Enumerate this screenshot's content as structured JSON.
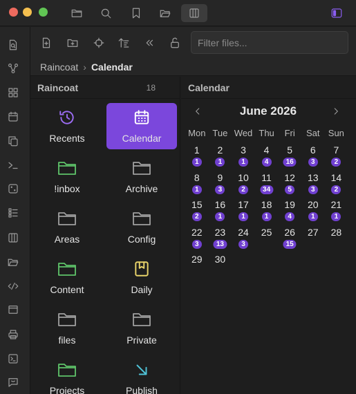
{
  "app": {
    "window_dots": [
      "#ed6a5e",
      "#f4bf4f",
      "#61c554"
    ],
    "accent": "#7b47dc",
    "titlebar_icons": [
      "folder-icon",
      "search-icon",
      "bookmark-icon",
      "folder-open-icon",
      "columns-icon"
    ],
    "sidebar_toggle_icon": "sidebar-toggle-icon"
  },
  "ribbon": {
    "icons": [
      "file-search-icon",
      "graph-icon",
      "grid-icon",
      "calendar-icon",
      "copy-icon",
      "terminal-icon",
      "dice-icon",
      "list-icon",
      "columns-icon",
      "folder-open-icon",
      "percent-code-icon",
      "window-icon",
      "print-icon",
      "terminal-box-icon",
      "chat-icon"
    ]
  },
  "toolbar": {
    "icons": [
      "new-note-icon",
      "new-folder-icon",
      "crosshair-icon",
      "sort-icon",
      "collapse-icon",
      "unlock-icon"
    ],
    "filter_placeholder": "Filter files..."
  },
  "breadcrumb": {
    "parent": "Raincoat",
    "separator": "›",
    "current": "Calendar"
  },
  "left_pane": {
    "title": "Raincoat",
    "count": "18",
    "tiles": [
      {
        "label": "Recents",
        "icon": "history-icon",
        "color": "#9b6cf2",
        "active": false
      },
      {
        "label": "Calendar",
        "icon": "calendar-icon",
        "color": "#ffffff",
        "active": true
      },
      {
        "label": "!inbox",
        "icon": "folder-icon",
        "color": "#5fc46a",
        "active": false
      },
      {
        "label": "Archive",
        "icon": "folder-icon",
        "color": "#a0a0a0",
        "active": false
      },
      {
        "label": "Areas",
        "icon": "folder-icon",
        "color": "#a0a0a0",
        "active": false
      },
      {
        "label": "Config",
        "icon": "folder-icon",
        "color": "#a0a0a0",
        "active": false
      },
      {
        "label": "Content",
        "icon": "folder-icon",
        "color": "#5fc46a",
        "active": false
      },
      {
        "label": "Daily",
        "icon": "bookmark-book-icon",
        "color": "#e8d36a",
        "active": false
      },
      {
        "label": "files",
        "icon": "folder-icon",
        "color": "#a0a0a0",
        "active": false
      },
      {
        "label": "Private",
        "icon": "folder-icon",
        "color": "#a0a0a0",
        "active": false
      },
      {
        "label": "Projects",
        "icon": "folder-icon",
        "color": "#5fc46a",
        "active": false
      },
      {
        "label": "Publish",
        "icon": "arrow-down-right-icon",
        "color": "#4fc3d8",
        "active": false
      }
    ]
  },
  "calendar": {
    "pane_title": "Calendar",
    "month_label": "June 2026",
    "weekdays": [
      "Mon",
      "Tue",
      "Wed",
      "Thu",
      "Fri",
      "Sat",
      "Sun"
    ],
    "weeks": [
      [
        {
          "d": "1",
          "n": "1"
        },
        {
          "d": "2",
          "n": "1"
        },
        {
          "d": "3",
          "n": "1"
        },
        {
          "d": "4",
          "n": "4"
        },
        {
          "d": "5",
          "n": "16"
        },
        {
          "d": "6",
          "n": "3"
        },
        {
          "d": "7",
          "n": "2"
        }
      ],
      [
        {
          "d": "8",
          "n": "1"
        },
        {
          "d": "9",
          "n": "3"
        },
        {
          "d": "10",
          "n": "2"
        },
        {
          "d": "11",
          "n": "34"
        },
        {
          "d": "12",
          "n": "5"
        },
        {
          "d": "13",
          "n": "3"
        },
        {
          "d": "14",
          "n": "2"
        }
      ],
      [
        {
          "d": "15",
          "n": "2"
        },
        {
          "d": "16",
          "n": "1"
        },
        {
          "d": "17",
          "n": "1"
        },
        {
          "d": "18",
          "n": "1"
        },
        {
          "d": "19",
          "n": "4"
        },
        {
          "d": "20",
          "n": "1"
        },
        {
          "d": "21",
          "n": "1"
        }
      ],
      [
        {
          "d": "22",
          "n": "3"
        },
        {
          "d": "23",
          "n": "13"
        },
        {
          "d": "24",
          "n": "3"
        },
        {
          "d": "25",
          "n": ""
        },
        {
          "d": "26",
          "n": "15"
        },
        {
          "d": "27",
          "n": ""
        },
        {
          "d": "28",
          "n": ""
        }
      ],
      [
        {
          "d": "29",
          "n": ""
        },
        {
          "d": "30",
          "n": ""
        }
      ]
    ]
  }
}
